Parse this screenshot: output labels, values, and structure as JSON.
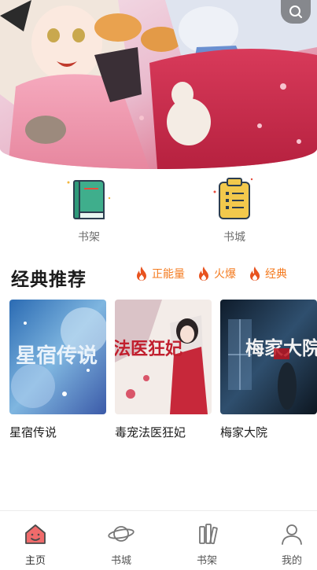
{
  "hero": {
    "alt": "anime banner",
    "search_icon": "search-icon"
  },
  "shortcuts": [
    {
      "label": "书架",
      "icon": "bookshelf-icon"
    },
    {
      "label": "书城",
      "icon": "bookstore-icon"
    }
  ],
  "section": {
    "title": "经典推荐",
    "tags": [
      {
        "label": "正能量",
        "icon": "flame-icon"
      },
      {
        "label": "火爆",
        "icon": "flame-icon"
      },
      {
        "label": "经典",
        "icon": "flame-icon"
      }
    ]
  },
  "books": [
    {
      "title": "星宿传说",
      "cover_text": "星宿传说"
    },
    {
      "title": "毒宠法医狂妃",
      "cover_text": "法医狂妃"
    },
    {
      "title": "梅家大院",
      "cover_text": "梅家大院"
    }
  ],
  "nav": [
    {
      "label": "主页",
      "icon": "home-icon"
    },
    {
      "label": "书城",
      "icon": "planet-icon"
    },
    {
      "label": "书架",
      "icon": "books-icon"
    },
    {
      "label": "我的",
      "icon": "user-icon"
    }
  ],
  "colors": {
    "accent": "#f47b20",
    "flame": "#e8531f",
    "shelf_green": "#3fae8c",
    "store_yellow": "#f2c94c"
  }
}
